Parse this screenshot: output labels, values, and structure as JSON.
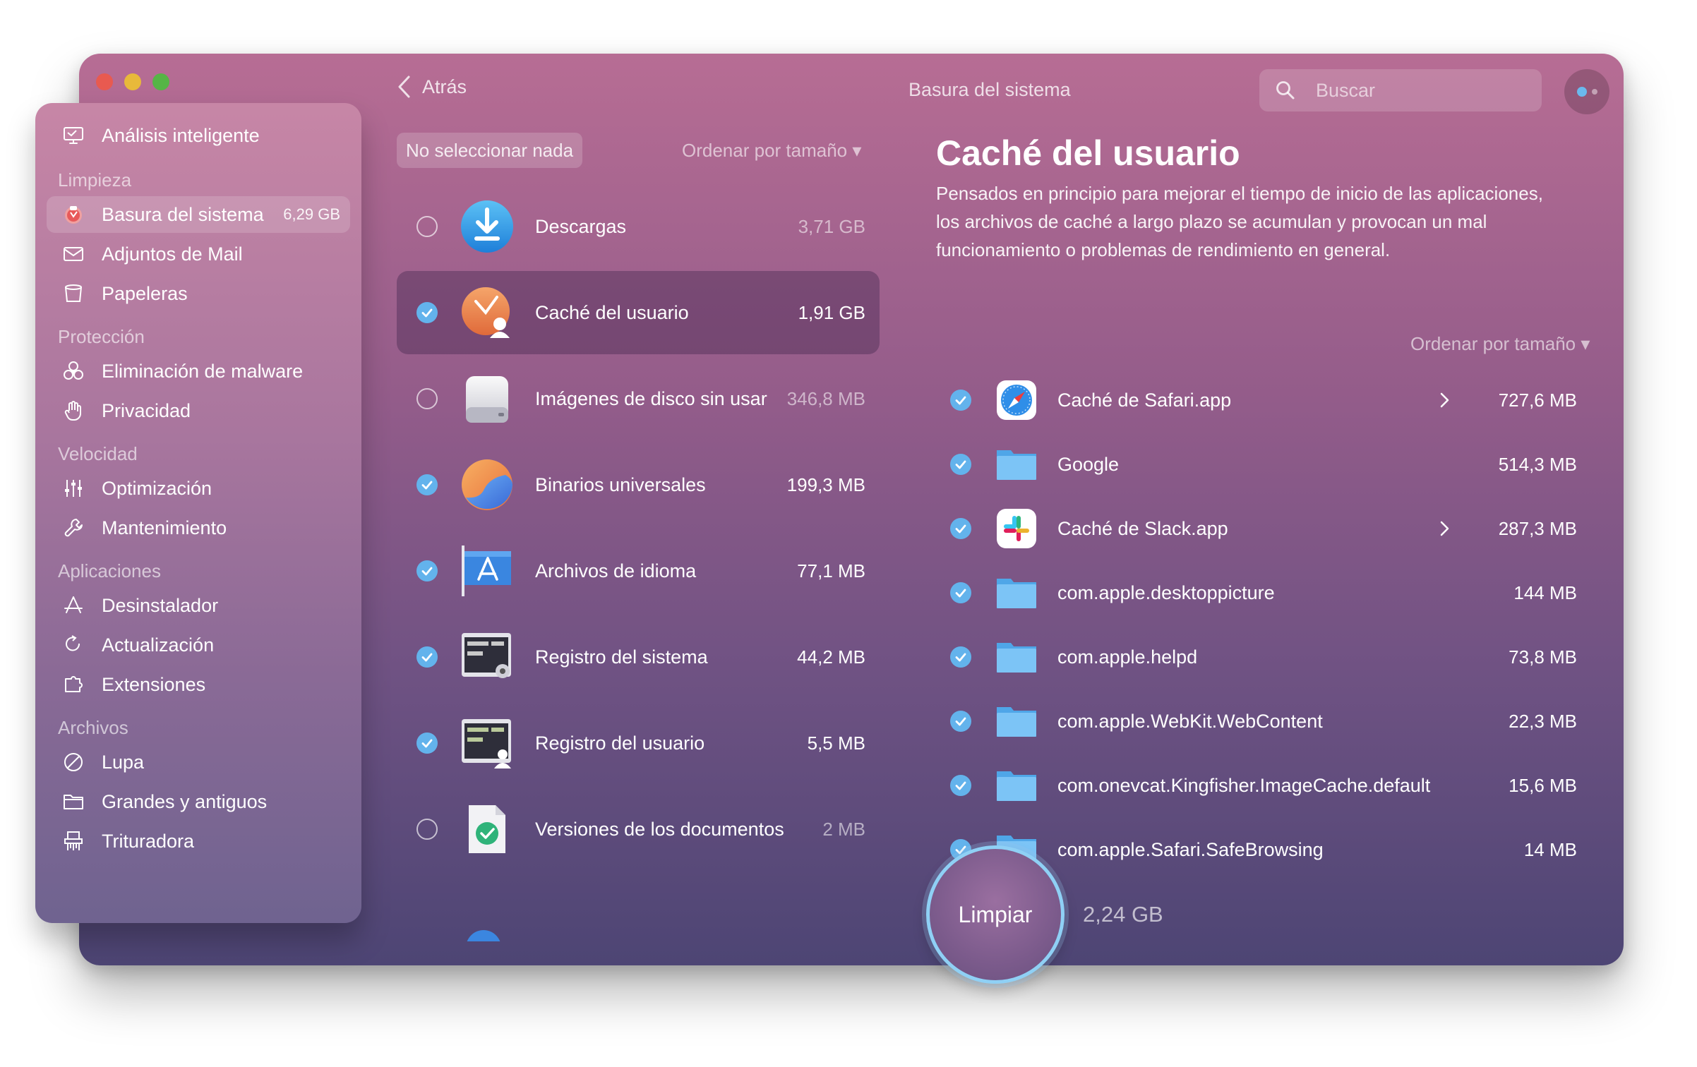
{
  "window": {
    "title": "Basura del sistema"
  },
  "toolbar": {
    "back_label": "Atrás",
    "search_placeholder": "Buscar"
  },
  "sidebar": {
    "top_item": {
      "label": "Análisis inteligente",
      "icon": "monitor-icon"
    },
    "sections": [
      {
        "title": "Limpieza",
        "items": [
          {
            "label": "Basura del sistema",
            "badge": "6,29 GB",
            "icon": "trash-bin-icon",
            "active": true
          },
          {
            "label": "Adjuntos de Mail",
            "icon": "mail-icon"
          },
          {
            "label": "Papeleras",
            "icon": "bin-icon"
          }
        ]
      },
      {
        "title": "Protección",
        "items": [
          {
            "label": "Eliminación de malware",
            "icon": "biohazard-icon"
          },
          {
            "label": "Privacidad",
            "icon": "hand-icon"
          }
        ]
      },
      {
        "title": "Velocidad",
        "items": [
          {
            "label": "Optimización",
            "icon": "sliders-icon"
          },
          {
            "label": "Mantenimiento",
            "icon": "wrench-icon"
          }
        ]
      },
      {
        "title": "Aplicaciones",
        "items": [
          {
            "label": "Desinstalador",
            "icon": "app-store-icon"
          },
          {
            "label": "Actualización",
            "icon": "update-icon"
          },
          {
            "label": "Extensiones",
            "icon": "extensions-icon"
          }
        ]
      },
      {
        "title": "Archivos",
        "items": [
          {
            "label": "Lupa",
            "icon": "lens-icon"
          },
          {
            "label": "Grandes y antiguos",
            "icon": "folder-icon"
          },
          {
            "label": "Trituradora",
            "icon": "shredder-icon"
          }
        ]
      }
    ]
  },
  "middle": {
    "select_none_label": "No seleccionar nada",
    "sort_label": "Ordenar por tamaño ▾",
    "items": [
      {
        "name": "Descargas",
        "size": "3,71 GB",
        "checked": false,
        "icon": "download-icon"
      },
      {
        "name": "Caché del usuario",
        "size": "1,91 GB",
        "checked": true,
        "selected": true,
        "icon": "user-cache-icon"
      },
      {
        "name": "Imágenes de disco sin usar",
        "size": "346,8 MB",
        "checked": false,
        "icon": "disk-image-icon"
      },
      {
        "name": "Binarios universales",
        "size": "199,3 MB",
        "checked": true,
        "icon": "universal-binary-icon"
      },
      {
        "name": "Archivos de idioma",
        "size": "77,1 MB",
        "checked": true,
        "icon": "language-files-icon"
      },
      {
        "name": "Registro del sistema",
        "size": "44,2 MB",
        "checked": true,
        "icon": "system-log-icon"
      },
      {
        "name": "Registro del usuario",
        "size": "5,5 MB",
        "checked": true,
        "icon": "user-log-icon"
      },
      {
        "name": "Versiones de los documentos",
        "size": "2 MB",
        "checked": false,
        "icon": "document-versions-icon"
      }
    ]
  },
  "detail": {
    "title": "Caché del usuario",
    "description": "Pensados en principio para mejorar el tiempo de inicio de las aplicaciones, los archivos de caché a largo plazo se acumulan y provocan un mal funcionamiento o problemas de rendimiento en general.",
    "sort_label": "Ordenar por tamaño ▾",
    "items": [
      {
        "name": "Caché de Safari.app",
        "size": "727,6 MB",
        "expandable": true,
        "icon": "safari-icon"
      },
      {
        "name": "Google",
        "size": "514,3 MB",
        "expandable": false,
        "icon": "folder-icon"
      },
      {
        "name": "Caché de Slack.app",
        "size": "287,3 MB",
        "expandable": true,
        "icon": "slack-icon"
      },
      {
        "name": "com.apple.desktoppicture",
        "size": "144 MB",
        "expandable": false,
        "icon": "folder-icon"
      },
      {
        "name": "com.apple.helpd",
        "size": "73,8 MB",
        "expandable": false,
        "icon": "folder-icon"
      },
      {
        "name": "com.apple.WebKit.WebContent",
        "size": "22,3 MB",
        "expandable": false,
        "icon": "folder-icon"
      },
      {
        "name": "com.onevcat.Kingfisher.ImageCache.default",
        "size": "15,6 MB",
        "expandable": false,
        "icon": "folder-icon"
      },
      {
        "name": "com.apple.Safari.SafeBrowsing",
        "size": "14 MB",
        "expandable": false,
        "icon": "folder-icon"
      }
    ]
  },
  "footer": {
    "clean_label": "Limpiar",
    "total": "2,24 GB"
  },
  "colors": {
    "accent": "#63b3ec",
    "window_top": "#b76d94",
    "window_bottom": "#4d4574"
  }
}
